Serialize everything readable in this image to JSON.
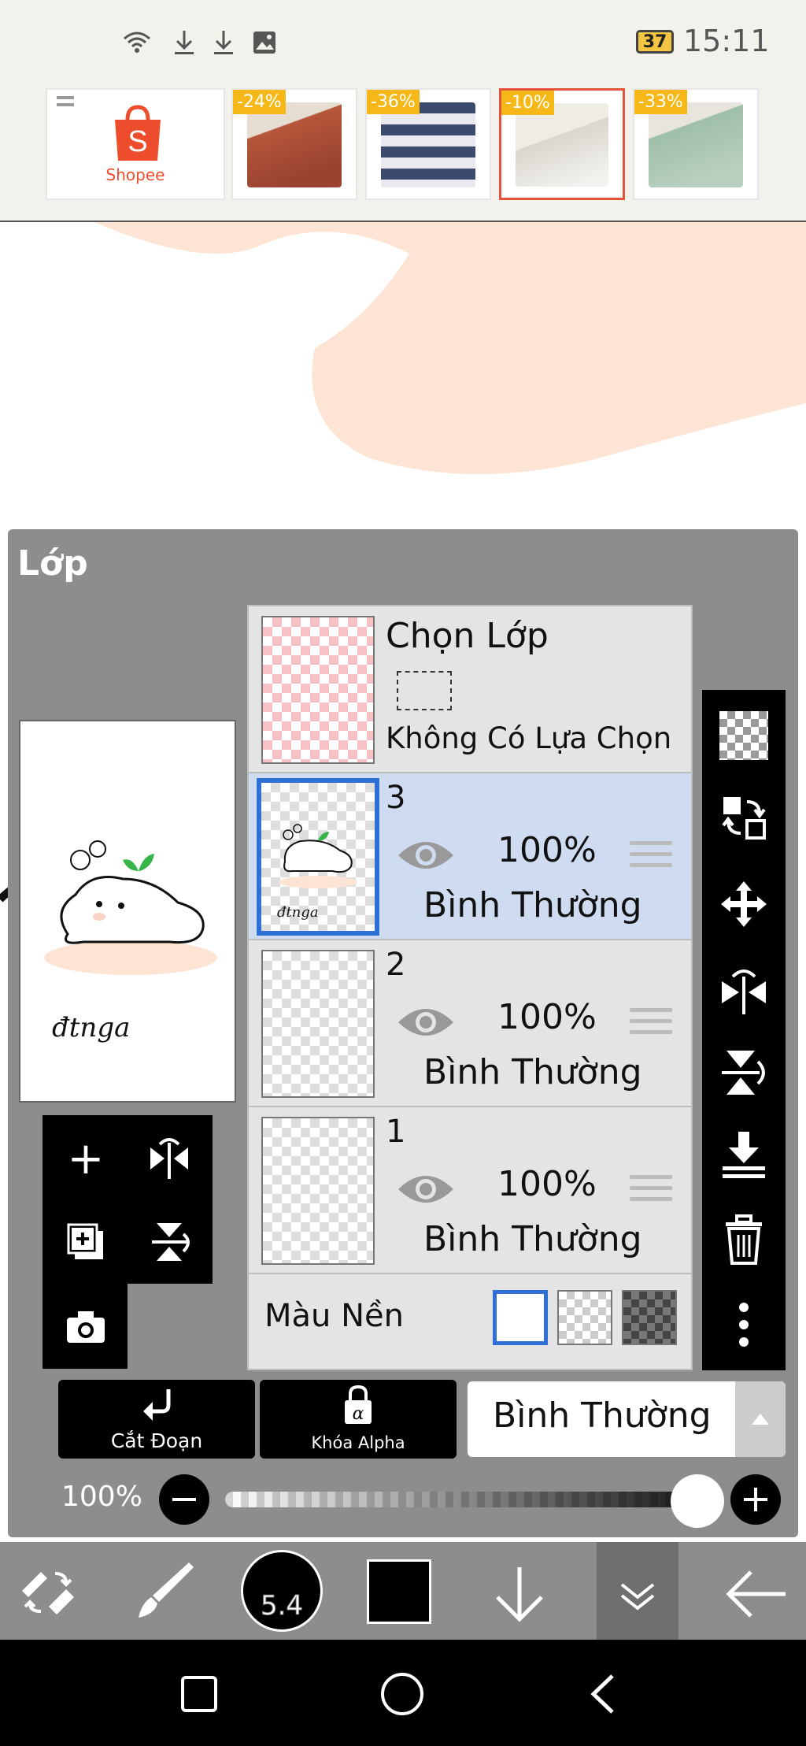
{
  "status_bar": {
    "time": "15:11",
    "battery_level": "37",
    "icons": [
      "wifi-icon",
      "download-icon",
      "download-icon",
      "image-icon"
    ]
  },
  "ad_banner": {
    "brand": "Shopee",
    "brand_color": "#ee4d2d",
    "discount_color": "#f6b818",
    "products": [
      {
        "discount": "-24%",
        "color": "#b5563a"
      },
      {
        "discount": "-36%",
        "color": "#3c4a6e"
      },
      {
        "discount": "-10%",
        "color": "#d9d6cf"
      },
      {
        "discount": "-33%",
        "color": "#9fbfa8"
      }
    ]
  },
  "layer_panel": {
    "title": "Lớp",
    "selection_layer": {
      "title": "Chọn Lớp",
      "subtitle": "Không Có Lựa Chọn"
    },
    "layers": [
      {
        "number": "3",
        "opacity": "100%",
        "mode": "Bình Thường",
        "selected": true
      },
      {
        "number": "2",
        "opacity": "100%",
        "mode": "Bình Thường",
        "selected": false
      },
      {
        "number": "1",
        "opacity": "100%",
        "mode": "Bình Thường",
        "selected": false
      }
    ],
    "background_label": "Màu Nền",
    "selected_color": "#cfdbf0",
    "accent_color": "#2f6fd6"
  },
  "controls": {
    "clip_label": "Cắt Đoạn",
    "alpha_lock_label": "Khóa Alpha",
    "blend_mode": "Bình Thường",
    "opacity_label": "100%",
    "opacity_value": 1.0
  },
  "drawing": {
    "signature": "đtnga"
  },
  "toolbar": {
    "brush_size": "5.4",
    "current_color": "#000000"
  }
}
